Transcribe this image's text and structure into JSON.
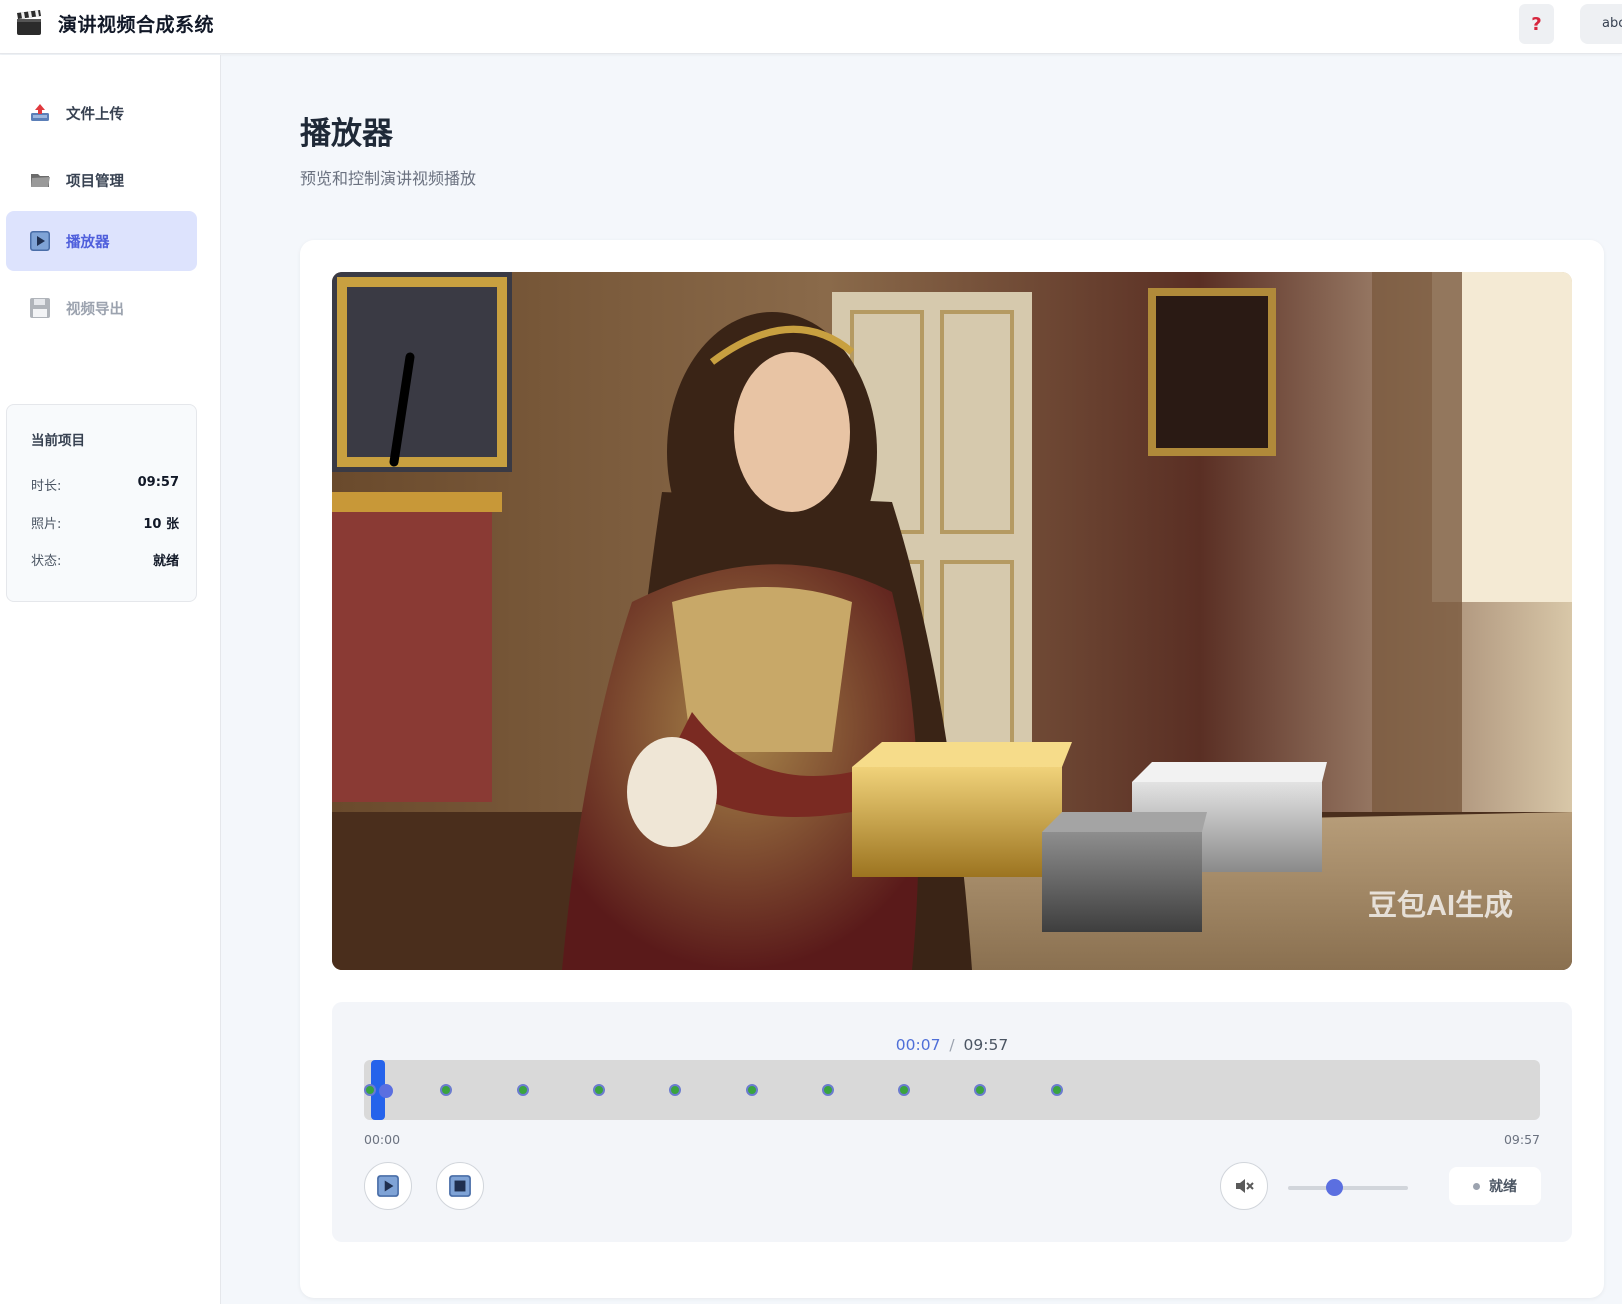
{
  "app": {
    "title": "演讲视频合成系统",
    "help_label": "?",
    "user_label": "abc"
  },
  "sidebar": {
    "items": [
      {
        "label": "文件上传",
        "icon": "upload-inbox-icon",
        "state": "normal"
      },
      {
        "label": "项目管理",
        "icon": "folder-icon",
        "state": "normal"
      },
      {
        "label": "播放器",
        "icon": "play-button-icon",
        "state": "active"
      },
      {
        "label": "视频导出",
        "icon": "floppy-disk-icon",
        "state": "disabled"
      }
    ],
    "project": {
      "title": "当前项目",
      "duration_label": "时长:",
      "duration_value": "09:57",
      "photos_label": "照片:",
      "photos_value": "10 张",
      "status_label": "状态:",
      "status_value": "就绪"
    }
  },
  "page": {
    "title": "播放器",
    "subtitle": "预览和控制演讲视频播放"
  },
  "video": {
    "watermark": "豆包AI生成"
  },
  "player": {
    "current_time": "00:07",
    "separator": "/",
    "total_time": "09:57",
    "start_label": "00:00",
    "end_label": "09:57",
    "progress_fraction": 0.012,
    "slide_marker_count": 10,
    "volume_fraction": 0.38,
    "status_label": "就绪",
    "accent_color": "#2563eb",
    "marker_color": "#3aa43e"
  }
}
